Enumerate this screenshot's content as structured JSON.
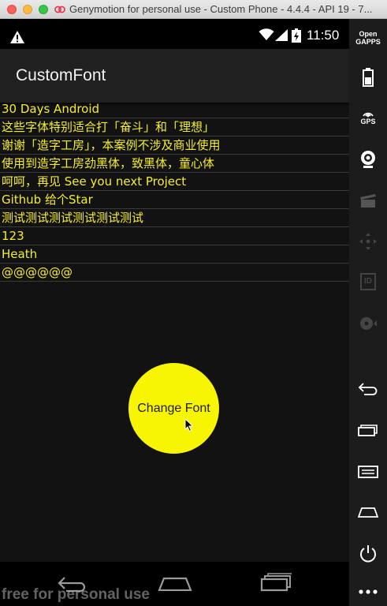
{
  "window": {
    "title": "Genymotion for personal use - Custom Phone - 4.4.4 - API 19 - 7..."
  },
  "status_bar": {
    "time": "11:50",
    "icons": [
      "warning-icon",
      "wifi-icon",
      "signal-icon",
      "battery-icon"
    ]
  },
  "app_bar": {
    "title": "CustomFont"
  },
  "list": {
    "items": [
      "30 Days Android",
      "这些字体特别适合打「奋斗」和「理想」",
      "谢谢「造字工房」，本案例不涉及商业使用",
      "使用到造字工房劲黑体，致黑体，童心体",
      "呵呵，再见 See you next Project",
      "Github 给个Star",
      "测试测试测试测试测试测试",
      "123",
      "Heath",
      "@@@@@@"
    ],
    "text_color": "#f5ee2c"
  },
  "fab": {
    "label": "Change Font",
    "color": "#f7f500"
  },
  "watermark": "free for personal use",
  "sidebar": {
    "open_gapps_label": "Open\nGAPPS",
    "gps_label": "GPS",
    "id_label": "ID",
    "icons": [
      "open-gapps-icon",
      "battery-widget-icon",
      "gps-icon",
      "webcam-icon",
      "clapper-icon",
      "dpad-icon",
      "id-icon",
      "disk-icon",
      "back-icon",
      "recent-apps-icon",
      "menu-icon",
      "home-icon",
      "power-icon",
      "more-icon"
    ]
  }
}
